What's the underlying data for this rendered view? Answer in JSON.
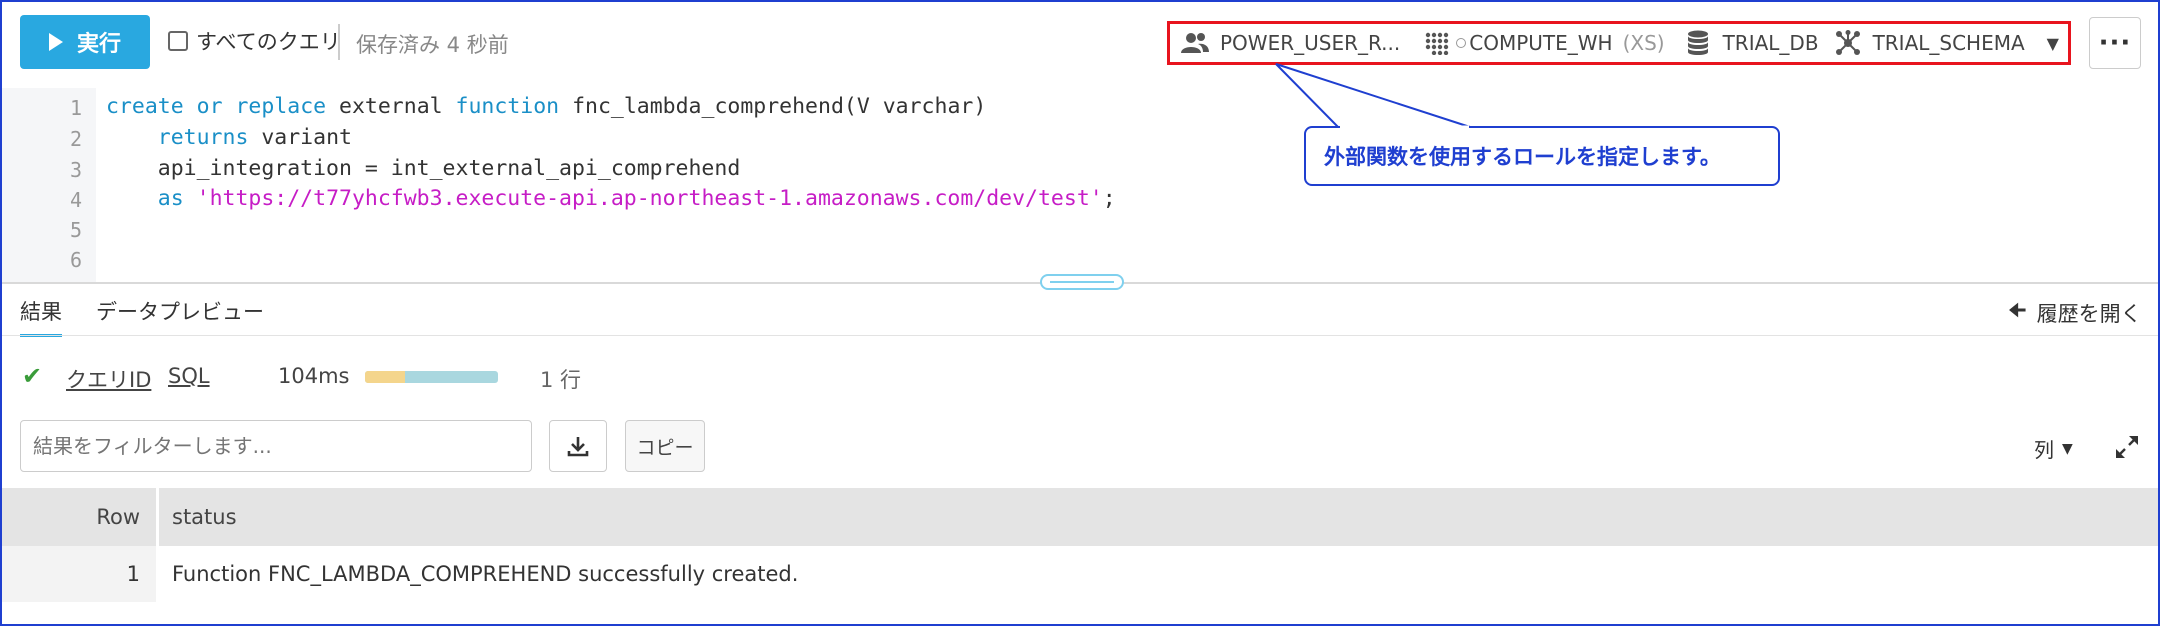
{
  "toolbar": {
    "run_label": "実行",
    "all_queries_label": "すべてのクエリ",
    "saved_status": "保存済み 4 秒前"
  },
  "context": {
    "role": "POWER_USER_R...",
    "warehouse": "COMPUTE_WH",
    "warehouse_size": "(XS)",
    "database": "TRIAL_DB",
    "schema": "TRIAL_SCHEMA",
    "more_label": "···"
  },
  "editor": {
    "line_numbers": [
      "1",
      "2",
      "3",
      "4",
      "5",
      "6"
    ],
    "line1": {
      "kw1": "create",
      "kw2": "or",
      "kw3": "replace",
      "t1": "external",
      "kw4": "function",
      "t2": "fnc_lambda_comprehend(V varchar)"
    },
    "line2": {
      "indent": "    ",
      "kw": "returns",
      "t": "variant"
    },
    "line3": {
      "indent": "    ",
      "t": "api_integration = int_external_api_comprehend"
    },
    "line4": {
      "indent": "    ",
      "kw": "as",
      "str": "'https://t77yhcfwb3.execute-api.ap-northeast-1.amazonaws.com/dev/test'",
      "t": ";"
    }
  },
  "callout": {
    "text": "外部関数を使用するロールを指定します。"
  },
  "results": {
    "tab_results": "結果",
    "tab_preview": "データプレビュー",
    "history_label": "履歴を開く",
    "query_id_label": "クエリID",
    "sql_label": "SQL",
    "duration": "104ms",
    "duration_compile_fraction": 0.3,
    "row_count": "1 行",
    "filter_placeholder": "結果をフィルターします...",
    "copy_label": "コピー",
    "columns_label": "列"
  },
  "table": {
    "headers": [
      "Row",
      "status"
    ],
    "rows": [
      {
        "row": "1",
        "status": "Function FNC_LAMBDA_COMPREHEND successfully created."
      }
    ]
  },
  "colors": {
    "accent": "#29a8e0",
    "highlight_box": "#e8141e",
    "callout_blue": "#1f3fd0",
    "keyword": "#1a8fc7",
    "string": "#c61dc6",
    "success": "#3a9c3a"
  }
}
